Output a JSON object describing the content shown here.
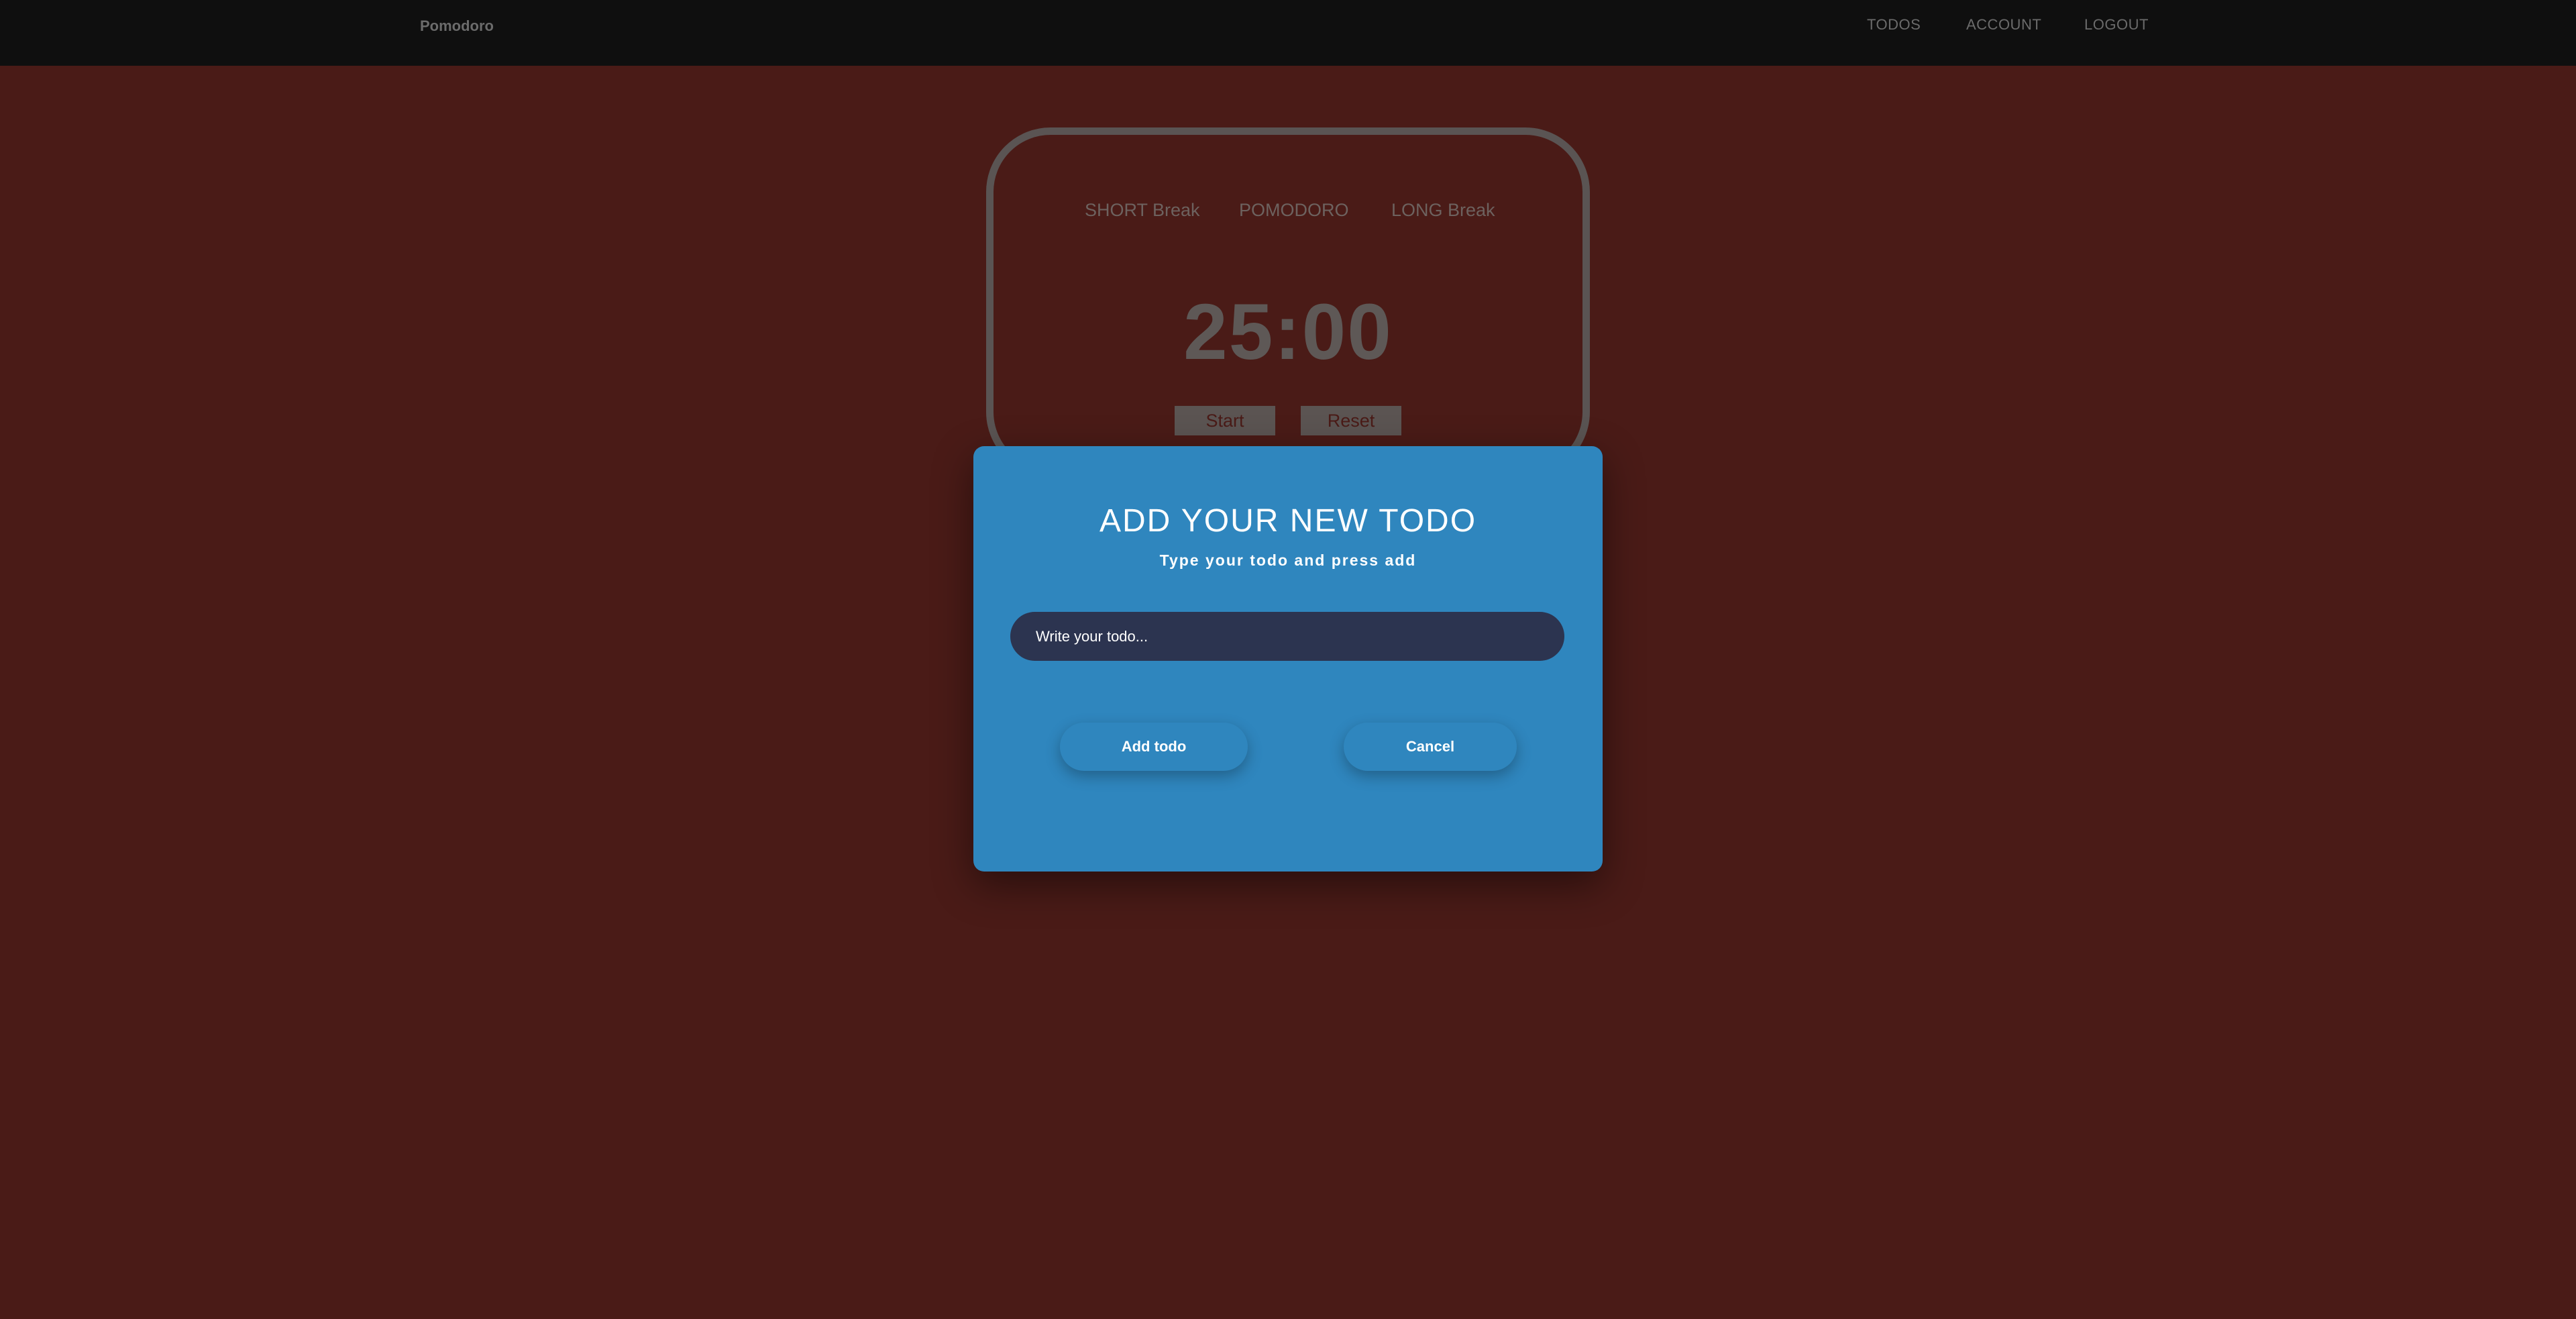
{
  "navbar": {
    "brand": "Pomodoro",
    "links": {
      "todos": "TODOS",
      "account": "ACCOUNT",
      "logout": "LOGOUT"
    }
  },
  "timer": {
    "tabs": {
      "short": "SHORT Break",
      "pomodoro": "POMODORO",
      "long": "LONG Break"
    },
    "display": "25:00",
    "start_label": "Start",
    "reset_label": "Reset"
  },
  "modal": {
    "title": "ADD YOUR NEW TODO",
    "subtitle": "Type your todo and press add",
    "input": {
      "placeholder": "Write your todo...",
      "value": ""
    },
    "add_label": "Add todo",
    "cancel_label": "Cancel"
  },
  "colors": {
    "background": "#4a1b17",
    "navbar": "#0f0f0f",
    "modal": "#2f86be",
    "input": "#2c3450"
  }
}
